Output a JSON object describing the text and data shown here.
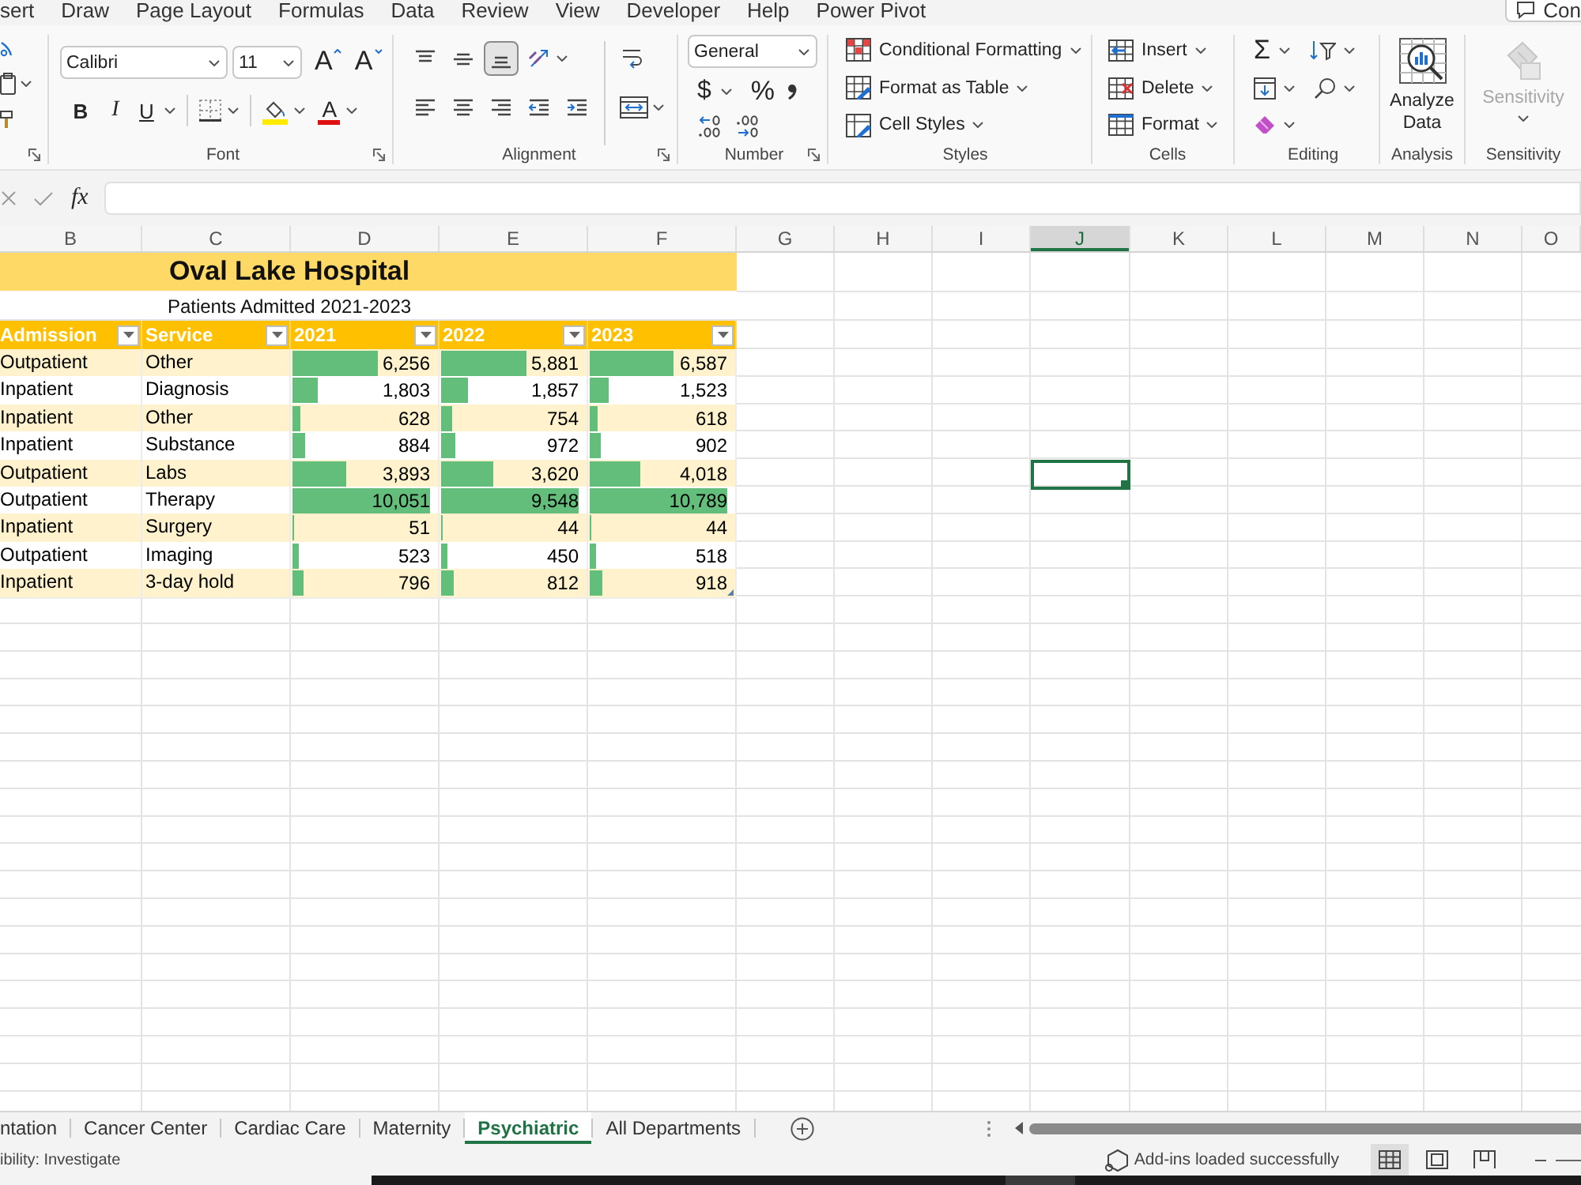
{
  "ribbon_tabs": [
    {
      "label": "sert",
      "selected": false
    },
    {
      "label": "Draw",
      "selected": false
    },
    {
      "label": "Page Layout",
      "selected": false
    },
    {
      "label": "Formulas",
      "selected": false
    },
    {
      "label": "Data",
      "selected": false
    },
    {
      "label": "Review",
      "selected": false
    },
    {
      "label": "View",
      "selected": false
    },
    {
      "label": "Developer",
      "selected": false
    },
    {
      "label": "Help",
      "selected": false
    },
    {
      "label": "Power Pivot",
      "selected": false
    }
  ],
  "comments_button": {
    "label": "Con"
  },
  "ribbon": {
    "font": {
      "label": "Font",
      "font_name": "Calibri",
      "font_size": "11",
      "grow_font": "A",
      "shrink_font": "A",
      "bold": "B",
      "italic": "I",
      "underline": "U",
      "font_color": "A"
    },
    "alignment": {
      "label": "Alignment",
      "vertical": [
        {
          "kind": "top",
          "selected": false
        },
        {
          "kind": "middle",
          "selected": false
        },
        {
          "kind": "bottom",
          "selected": true
        }
      ],
      "horizontal": [
        {
          "kind": "left",
          "selected": false
        },
        {
          "kind": "center",
          "selected": false
        },
        {
          "kind": "right",
          "selected": false
        }
      ]
    },
    "number": {
      "label": "Number",
      "format": "General",
      "currency": "$",
      "percent": "%"
    },
    "styles": {
      "label": "Styles",
      "items": [
        {
          "kind": "conditional",
          "label": "Conditional Formatting"
        },
        {
          "kind": "table",
          "label": "Format as Table"
        },
        {
          "kind": "cell-styles",
          "label": "Cell Styles"
        }
      ]
    },
    "cells": {
      "label": "Cells",
      "items": [
        {
          "kind": "insert",
          "label": "Insert"
        },
        {
          "kind": "delete",
          "label": "Delete"
        },
        {
          "kind": "format",
          "label": "Format"
        }
      ]
    },
    "editing": {
      "label": "Editing",
      "autosum": "Σ"
    },
    "analysis": {
      "label": "Analysis",
      "button": "Analyze Data"
    },
    "sensitivity": {
      "label": "Sensitivity",
      "button": "Sensitivity",
      "disabled": true
    }
  },
  "formula_bar": {
    "function_label": "fx"
  },
  "columns": [
    {
      "label": "B",
      "selected": false
    },
    {
      "label": "C",
      "selected": false
    },
    {
      "label": "D",
      "selected": false
    },
    {
      "label": "E",
      "selected": false
    },
    {
      "label": "F",
      "selected": false
    },
    {
      "label": "G",
      "selected": false
    },
    {
      "label": "H",
      "selected": false
    },
    {
      "label": "I",
      "selected": false
    },
    {
      "label": "J",
      "selected": true
    },
    {
      "label": "K",
      "selected": false
    },
    {
      "label": "L",
      "selected": false
    },
    {
      "label": "M",
      "selected": false
    },
    {
      "label": "N",
      "selected": false
    },
    {
      "label": "O",
      "selected": false
    }
  ],
  "table": {
    "title": "Oval Lake Hospital",
    "subtitle": "Patients Admitted 2021-2023",
    "headers": [
      "Admission",
      "Service",
      "2021",
      "2022",
      "2023"
    ],
    "rows": [
      {
        "admission": "Outpatient",
        "service": "Other",
        "active": false,
        "values": [
          {
            "text": "6,256",
            "level": 0.62
          },
          {
            "text": "5,881",
            "level": 0.62
          },
          {
            "text": "6,587",
            "level": 0.61
          }
        ]
      },
      {
        "admission": "Inpatient",
        "service": "Diagnosis",
        "active": false,
        "values": [
          {
            "text": "1,803",
            "level": 0.18
          },
          {
            "text": "1,857",
            "level": 0.19
          },
          {
            "text": "1,523",
            "level": 0.14
          }
        ]
      },
      {
        "admission": "Inpatient",
        "service": "Other",
        "active": false,
        "values": [
          {
            "text": "628",
            "level": 0.06
          },
          {
            "text": "754",
            "level": 0.08
          },
          {
            "text": "618",
            "level": 0.06
          }
        ]
      },
      {
        "admission": "Inpatient",
        "service": "Substance",
        "active": false,
        "values": [
          {
            "text": "884",
            "level": 0.09
          },
          {
            "text": "972",
            "level": 0.1
          },
          {
            "text": "902",
            "level": 0.08
          }
        ]
      },
      {
        "admission": "Outpatient",
        "service": "Labs",
        "active": true,
        "values": [
          {
            "text": "3,893",
            "level": 0.39
          },
          {
            "text": "3,620",
            "level": 0.38
          },
          {
            "text": "4,018",
            "level": 0.37
          }
        ]
      },
      {
        "admission": "Outpatient",
        "service": "Therapy",
        "active": false,
        "values": [
          {
            "text": "10,051",
            "level": 1
          },
          {
            "text": "9,548",
            "level": 1
          },
          {
            "text": "10,789",
            "level": 1
          }
        ]
      },
      {
        "admission": "Inpatient",
        "service": "Surgery",
        "active": false,
        "values": [
          {
            "text": "51",
            "level": 0.005
          },
          {
            "text": "44",
            "level": 0.005
          },
          {
            "text": "44",
            "level": 0.004
          }
        ]
      },
      {
        "admission": "Outpatient",
        "service": "Imaging",
        "active": false,
        "values": [
          {
            "text": "523",
            "level": 0.05
          },
          {
            "text": "450",
            "level": 0.05
          },
          {
            "text": "518",
            "level": 0.05
          }
        ]
      },
      {
        "admission": "Inpatient",
        "service": "3-day hold",
        "active": false,
        "values": [
          {
            "text": "796",
            "level": 0.08
          },
          {
            "text": "812",
            "level": 0.09
          },
          {
            "text": "918",
            "level": 0.09
          }
        ]
      }
    ]
  },
  "sheet_tabs": [
    {
      "label": "ntation",
      "selected": false
    },
    {
      "label": "Cancer Center",
      "selected": false
    },
    {
      "label": "Cardiac Care",
      "selected": false
    },
    {
      "label": "Maternity",
      "selected": false
    },
    {
      "label": "Psychiatric",
      "selected": true
    },
    {
      "label": "All Departments",
      "selected": false
    }
  ],
  "status_bar": {
    "accessibility": "ibility: Investigate",
    "message": "Add-ins loaded successfully",
    "views": [
      {
        "kind": "normal",
        "selected": true
      },
      {
        "kind": "page-layout",
        "selected": false
      },
      {
        "kind": "page-break",
        "selected": false
      }
    ]
  }
}
